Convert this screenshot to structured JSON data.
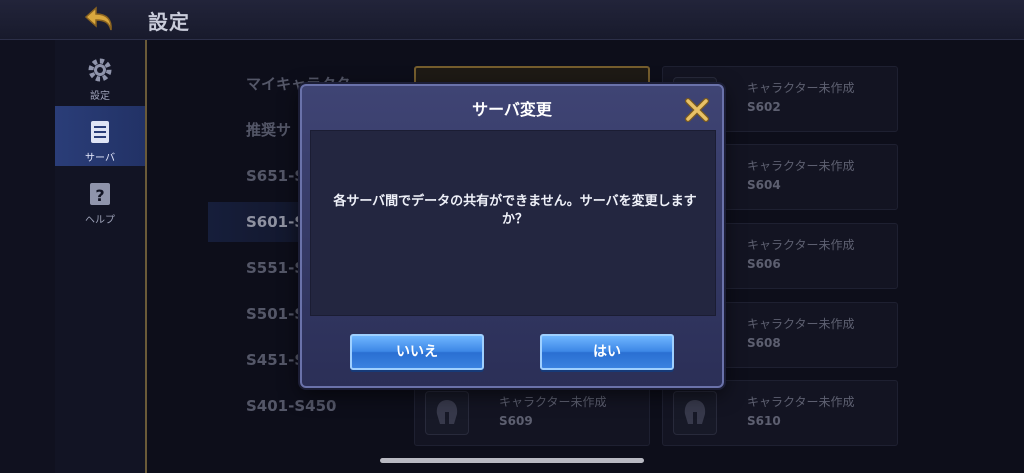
{
  "header": {
    "title": "設定",
    "back_icon": "back-arrow-icon"
  },
  "nav": {
    "items": [
      {
        "label": "設定",
        "icon": "gear-icon",
        "active": false
      },
      {
        "label": "サーバ",
        "icon": "server-icon",
        "active": true
      },
      {
        "label": "ヘルプ",
        "icon": "help-icon",
        "active": false
      }
    ]
  },
  "server_list": [
    {
      "label": "マイキャラクター"
    },
    {
      "label": "推奨サ"
    },
    {
      "label": "S651-S"
    },
    {
      "label": "S601-S"
    },
    {
      "label": "S551-S"
    },
    {
      "label": "S501-S"
    },
    {
      "label": "S451-S"
    },
    {
      "label": "S401-S450"
    }
  ],
  "cards": [
    {
      "line1": "キャラクター未作成",
      "line2": "S602"
    },
    {
      "line1": "キャラクター未作成",
      "line2": "S604"
    },
    {
      "line1": "キャラクター未作成",
      "line2": "S606"
    },
    {
      "line1": "キャラクター未作成",
      "line2": "S608"
    },
    {
      "line1": "キャラクター未作成",
      "line2": "S609"
    },
    {
      "line1": "キャラクター未作成",
      "line2": "S610"
    }
  ],
  "modal": {
    "title": "サーバ変更",
    "message": "各サーバ間でデータの共有ができません。サーバを変更しますか？",
    "no_label": "いいえ",
    "yes_label": "はい"
  },
  "colors": {
    "accent": "#3d87e6",
    "gold": "#b08a3c"
  }
}
